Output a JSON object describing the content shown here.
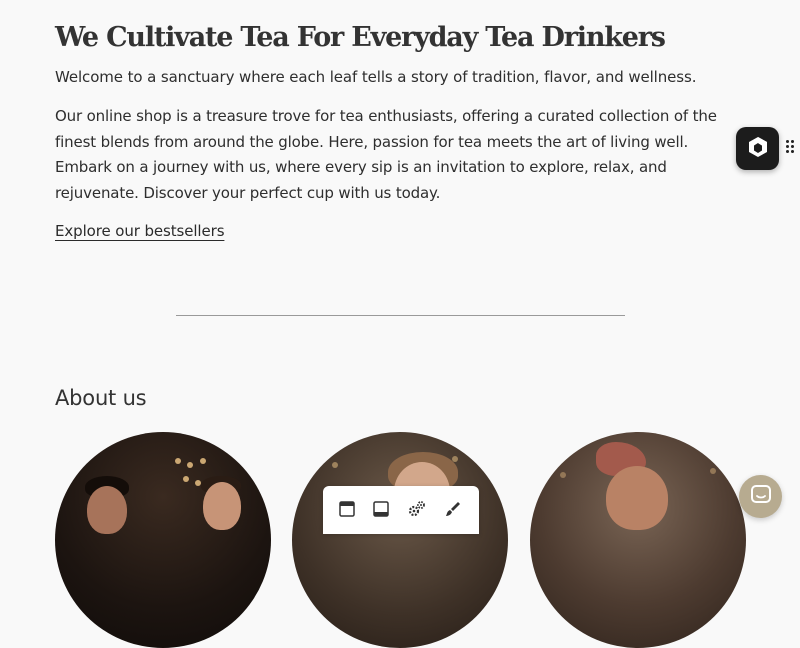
{
  "hero": {
    "title": "We Cultivate Tea For Everyday Tea Drinkers",
    "intro": "Welcome to a sanctuary where each leaf tells a story of tradition, flavor, and wellness.",
    "body": "Our online shop is a treasure trove for tea enthusiasts, offering a curated collection of the finest blends from around the globe. Here, passion for tea meets the art of living well. Embark on a journey with us, where every sip is an invitation to explore, relax, and rejuvenate. Discover your perfect cup with us today.",
    "link": "Explore our bestsellers"
  },
  "about": {
    "heading": "About us",
    "photos": [
      "team-photo-1",
      "team-photo-2",
      "team-photo-3"
    ]
  },
  "widget": {
    "icon": "hexagon-logo-icon",
    "handle_icon": "drag-handle-icon"
  },
  "toolbar": {
    "tools": [
      "header-section-icon",
      "footer-section-icon",
      "settings-gears-icon",
      "design-brush-icon"
    ]
  },
  "chat": {
    "icon": "chat-icon"
  },
  "colors": {
    "background": "#f9f9f9",
    "text": "#2e2e2e",
    "chat_accent": "#b7ab90",
    "widget_bg": "#1c1c1c"
  }
}
